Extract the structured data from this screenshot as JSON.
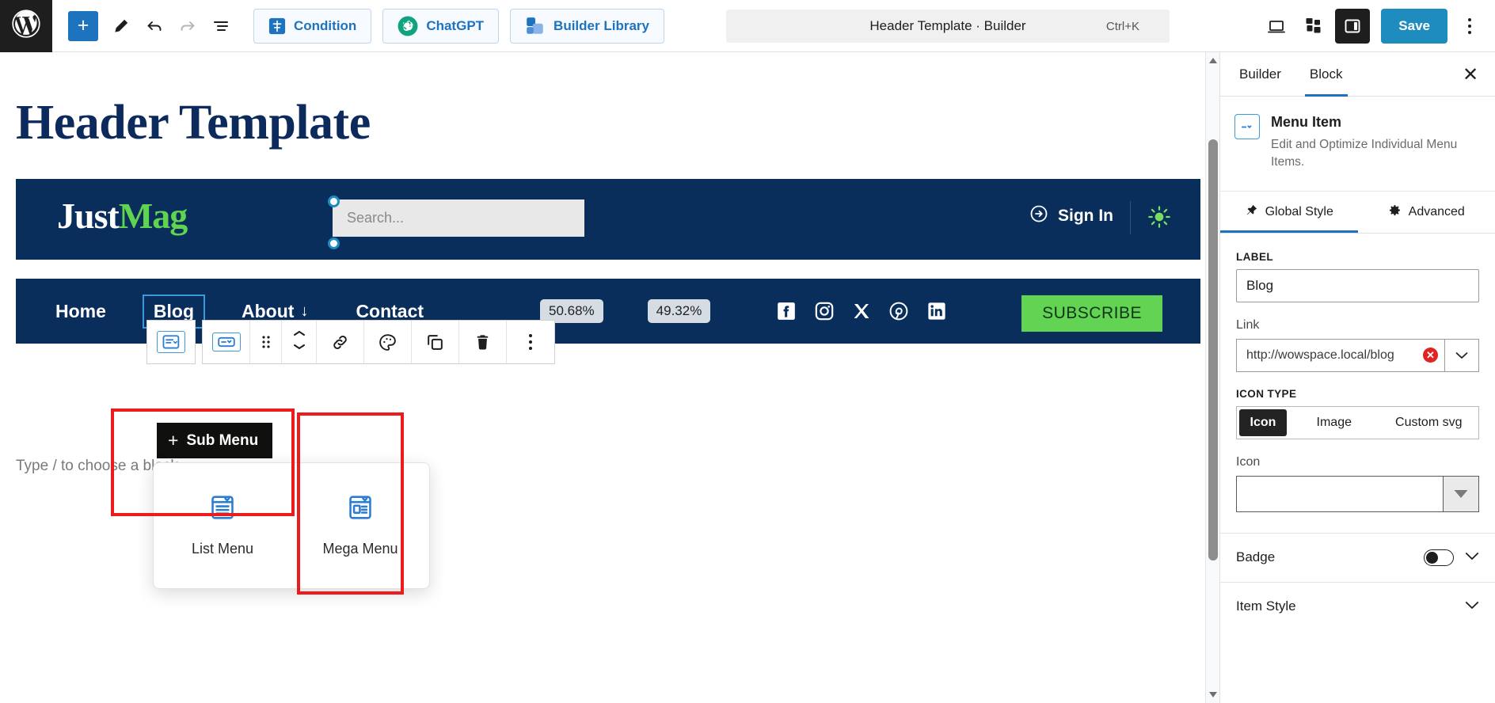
{
  "topbar": {
    "logo_icon": "wordpress-logo-icon",
    "add_block_label": "+",
    "tools": [
      {
        "name": "edit-pencil-icon",
        "label": "Edit"
      },
      {
        "name": "undo-icon",
        "label": "Undo"
      },
      {
        "name": "redo-icon",
        "label": "Redo"
      },
      {
        "name": "list-view-icon",
        "label": "Document Overview"
      }
    ],
    "condition_label": "Condition",
    "chatgpt_label": "ChatGPT",
    "builder_library_label": "Builder Library",
    "document_title": "Header Template · Builder",
    "command_shortcut": "Ctrl+K",
    "view_desktop_icon": "desktop-view-icon",
    "patterns_icon": "blocks-pattern-icon",
    "sidebar_toggle_icon": "settings-panel-icon",
    "save_label": "Save",
    "options_icon": "kebab-menu-icon"
  },
  "canvas": {
    "page_title": "Header Template",
    "appender_placeholder": "Type / to choose a block",
    "header": {
      "brand_first": "Just",
      "brand_second": "Mag",
      "search_placeholder": "Search...",
      "signin_label": "Sign In",
      "signin_icon": "arrow-in-circle-icon",
      "theme_toggle_icon": "sun-icon"
    },
    "nav": {
      "items": [
        {
          "label": "Home",
          "selected": false,
          "has_caret": false
        },
        {
          "label": "Blog",
          "selected": true,
          "has_caret": false
        },
        {
          "label": "About",
          "selected": false,
          "has_caret": true
        },
        {
          "label": "Contact",
          "selected": false,
          "has_caret": false
        }
      ],
      "badges": [
        "50.68%",
        "49.32%"
      ],
      "social": [
        {
          "name": "facebook-icon"
        },
        {
          "name": "instagram-icon"
        },
        {
          "name": "x-twitter-icon"
        },
        {
          "name": "pinterest-icon"
        },
        {
          "name": "linkedin-icon"
        }
      ],
      "subscribe_label": "SUBSCRIBE"
    },
    "submenu_chip": {
      "plus": "+",
      "label": "Sub Menu"
    },
    "popover": {
      "options": [
        {
          "label": "List Menu",
          "icon": "list-menu-icon"
        },
        {
          "label": "Mega Menu",
          "icon": "mega-menu-icon"
        }
      ]
    },
    "block_toolbar": {
      "parent_icon": "parent-block-menu-icon",
      "buttons": [
        {
          "name": "block-type-menu-item-icon"
        },
        {
          "name": "drag-handle-icon"
        },
        {
          "name": "move-up-down-icon"
        },
        {
          "name": "link-icon"
        },
        {
          "name": "color-palette-icon"
        },
        {
          "name": "duplicate-icon"
        },
        {
          "name": "delete-trash-icon"
        },
        {
          "name": "more-options-icon"
        }
      ]
    }
  },
  "sidebar": {
    "tabs": [
      {
        "label": "Builder",
        "active": false
      },
      {
        "label": "Block",
        "active": true
      }
    ],
    "close_label": "✕",
    "block": {
      "icon": "menu-item-block-icon",
      "title": "Menu Item",
      "description": "Edit and Optimize Individual Menu Items."
    },
    "subtabs": [
      {
        "label": "Global Style",
        "icon": "pin-icon",
        "active": true
      },
      {
        "label": "Advanced",
        "icon": "gear-icon",
        "active": false
      }
    ],
    "fields": {
      "label_caps": "LABEL",
      "label_value": "Blog",
      "link_label": "Link",
      "link_value": "http://wowspace.local/blog",
      "link_error_icon": "error-clear-icon",
      "icon_type_caps": "ICON TYPE",
      "icon_type_options": [
        "Icon",
        "Image",
        "Custom svg"
      ],
      "icon_type_selected": "Icon",
      "icon_label": "Icon",
      "icon_value": ""
    },
    "accordions": [
      {
        "label": "Badge",
        "has_toggle": true,
        "toggle_on": false
      },
      {
        "label": "Item Style",
        "has_toggle": false
      }
    ]
  },
  "colors": {
    "brand_blue": "#1e73be",
    "header_navy": "#0a2e5c",
    "accent_green": "#62d353",
    "annotation_red": "#ec1c1c",
    "save_blue": "#1e8cbe"
  }
}
